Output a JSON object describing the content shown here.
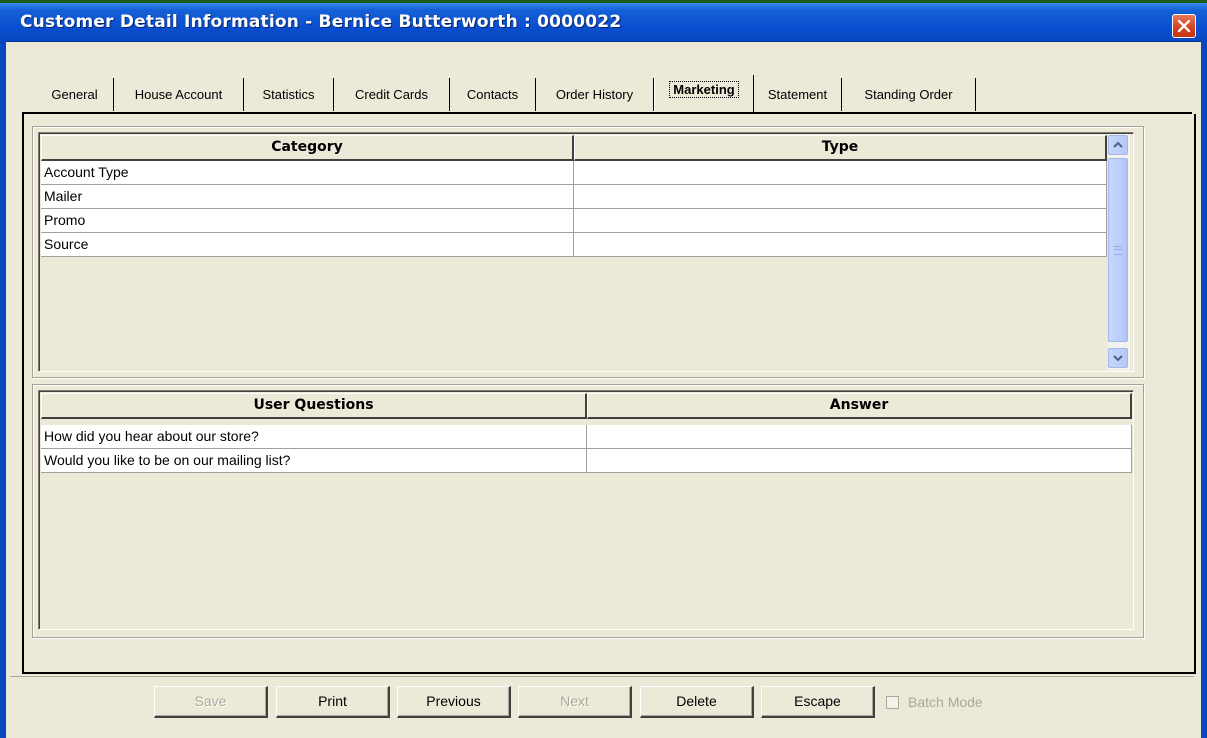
{
  "window": {
    "title": "Customer Detail Information - Bernice Butterworth : 0000022",
    "close_label": "✕"
  },
  "tabs": [
    {
      "label": "General",
      "active": false
    },
    {
      "label": "House Account",
      "active": false
    },
    {
      "label": "Statistics",
      "active": false
    },
    {
      "label": "Credit Cards",
      "active": false
    },
    {
      "label": "Contacts",
      "active": false
    },
    {
      "label": "Order History",
      "active": false
    },
    {
      "label": "Marketing",
      "active": true
    },
    {
      "label": "Statement",
      "active": false
    },
    {
      "label": "Standing Order",
      "active": false
    }
  ],
  "category_grid": {
    "headers": [
      "Category",
      "Type"
    ],
    "rows": [
      [
        "Account Type",
        ""
      ],
      [
        "Mailer",
        ""
      ],
      [
        "Promo",
        ""
      ],
      [
        "Source",
        ""
      ]
    ]
  },
  "questions_grid": {
    "headers": [
      "User Questions",
      "Answer"
    ],
    "rows": [
      [
        "How did you hear about our store?",
        ""
      ],
      [
        "Would you like to be on our mailing list?",
        ""
      ]
    ]
  },
  "buttons": {
    "save": "Save",
    "print": "Print",
    "previous": "Previous",
    "next": "Next",
    "delete": "Delete",
    "escape": "Escape",
    "batch_mode": "Batch Mode"
  },
  "colors": {
    "titlebar": "#0a4fd0",
    "face": "#ece9d8",
    "close": "#d8431f"
  }
}
